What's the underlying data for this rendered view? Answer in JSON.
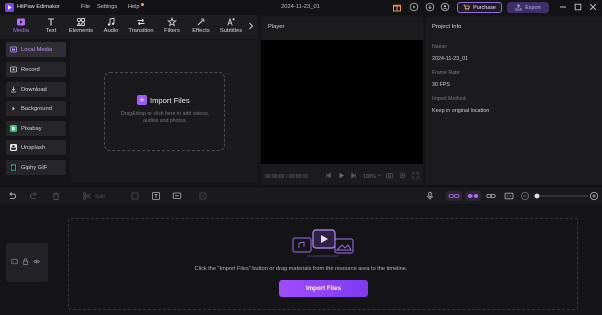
{
  "app": {
    "name": "HitPaw Edimakor",
    "project_name": "2024-11-23_01",
    "menu": [
      "File",
      "Settings",
      "Help"
    ],
    "purchase_label": "Purchase",
    "export_label": "Export"
  },
  "tabs": [
    {
      "label": "Media",
      "icon": "media-icon",
      "active": true
    },
    {
      "label": "Text",
      "icon": "text-icon"
    },
    {
      "label": "Elements",
      "icon": "elements-icon"
    },
    {
      "label": "Audio",
      "icon": "audio-icon"
    },
    {
      "label": "Transition",
      "icon": "transition-icon"
    },
    {
      "label": "Filters",
      "icon": "filters-icon"
    },
    {
      "label": "Effects",
      "icon": "effects-icon"
    },
    {
      "label": "Subtitles",
      "icon": "subtitles-icon"
    }
  ],
  "sidebar": {
    "items": [
      {
        "label": "Local Media",
        "active": true
      },
      {
        "label": "Record"
      },
      {
        "label": "Download"
      },
      {
        "label": "Background"
      },
      {
        "label": "Pixabay"
      },
      {
        "label": "Unsplash"
      },
      {
        "label": "Giphy GIF"
      }
    ]
  },
  "media": {
    "import_label": "Import Files",
    "drop_hint": "Drag&drop or click here to add videos, audios and photos."
  },
  "player": {
    "label": "Player",
    "time": "00:00:00 / 00:00:00",
    "speed": "100%"
  },
  "project_info": {
    "title": "Project Info",
    "name_label": "Name:",
    "name_value": "2024-11-23_01",
    "frame_rate_label": "Frame Rate:",
    "frame_rate_value": "30 FPS",
    "import_method_label": "Import Method:",
    "import_method_value": "Keep in original location"
  },
  "timeline": {
    "split_label": "Split",
    "hint": "Click the \"Import Files\" button or drag materials from the resource area to the timeline.",
    "import_button": "Import Files"
  },
  "colors": {
    "accent": "#9a5cf5",
    "background": "#151517",
    "panel": "#1b1b1e"
  }
}
